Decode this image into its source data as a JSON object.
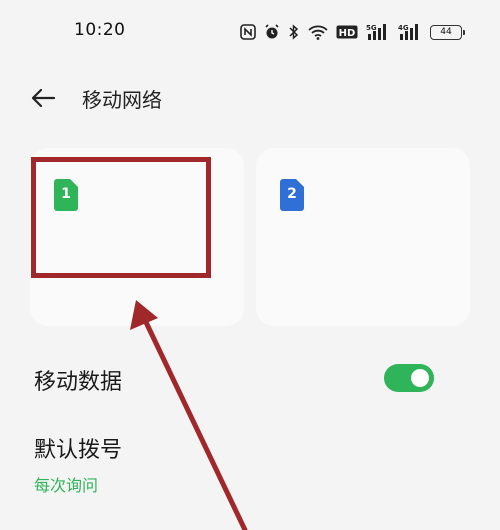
{
  "status_bar": {
    "time": "10:20",
    "battery": "44",
    "icons": [
      "nfc-icon",
      "alarm-icon",
      "bluetooth-icon",
      "wifi-icon",
      "hd-icon",
      "signal-5g-icon",
      "signal-4g-icon",
      "battery-icon"
    ],
    "hd_label": "HD",
    "net1": "5G",
    "net2": "4G"
  },
  "header": {
    "title": "移动网络",
    "back_icon": "back-arrow-icon"
  },
  "sim_cards": [
    {
      "number": "1",
      "color": "#2fb45a"
    },
    {
      "number": "2",
      "color": "#2f6fd6"
    }
  ],
  "settings": {
    "mobile_data": {
      "label": "移动数据",
      "enabled": true
    },
    "default_dial": {
      "label": "默认拨号",
      "value": "每次询问"
    }
  },
  "colors": {
    "accent_green": "#2fb45a",
    "annotation_red": "#a0282a"
  }
}
